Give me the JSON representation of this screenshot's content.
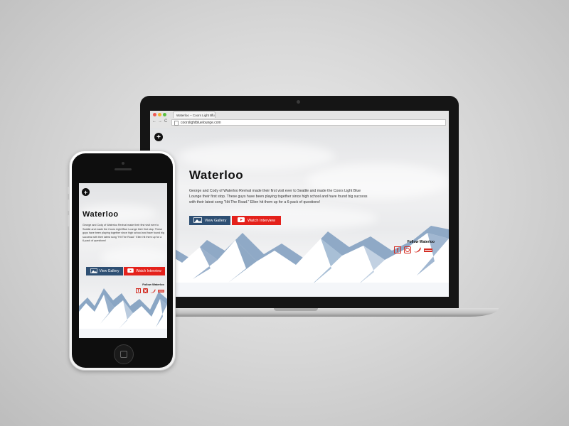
{
  "browser": {
    "tab_title": "Waterloo – Coors Light Blu",
    "tab_close": "×",
    "url": "coorslightbluelounge.com",
    "nav_back": "←",
    "nav_forward": "→",
    "nav_reload": "C"
  },
  "site": {
    "plus_label": "+",
    "title": "Waterloo",
    "description": "George and Cody of Waterloo Revival made their first visit ever to Seattle and made the Coors Light Blue Lounge their first stop. These guys have been playing together since high school and have found big success with their latest song \"Hit The Road.\" Ellen hit them up for a 6-pack of questions!",
    "gallery_label": "View Gallery",
    "watch_label": "Watch Interview",
    "follow_label": "Follow Waterloo",
    "social_icons": [
      "facebook-icon",
      "instagram-icon",
      "twitter-icon",
      "vevo-icon"
    ]
  },
  "colors": {
    "gallery_button": "#2e4f73",
    "watch_button": "#e4211b",
    "social": "#d32c22"
  }
}
